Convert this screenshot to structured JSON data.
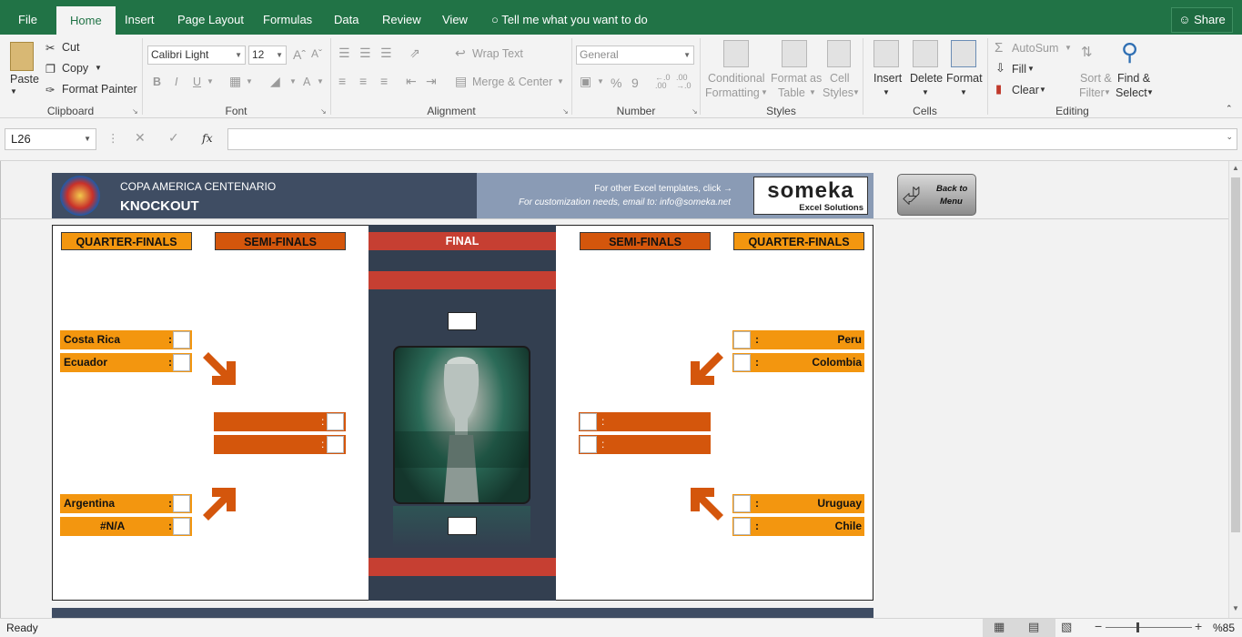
{
  "tabs": {
    "file": "File",
    "home": "Home",
    "insert": "Insert",
    "page_layout": "Page Layout",
    "formulas": "Formulas",
    "data": "Data",
    "review": "Review",
    "view": "View",
    "tell_me": "Tell me what you want to do",
    "share": "Share"
  },
  "clipboard": {
    "paste": "Paste",
    "cut": "Cut",
    "copy": "Copy",
    "format_painter": "Format Painter",
    "group": "Clipboard"
  },
  "font": {
    "name": "Calibri Light",
    "size": "12",
    "bold": "B",
    "italic": "I",
    "underline": "U",
    "color_a": "A",
    "group": "Font"
  },
  "alignment": {
    "wrap": "Wrap Text",
    "merge": "Merge & Center",
    "group": "Alignment"
  },
  "number": {
    "format": "General",
    "percent": "%",
    "comma": "9",
    "group": "Number"
  },
  "styles": {
    "conditional_l1": "Conditional",
    "conditional_l2": "Formatting",
    "format_table_l1": "Format as",
    "format_table_l2": "Table",
    "cell_styles_l1": "Cell",
    "cell_styles_l2": "Styles",
    "group": "Styles"
  },
  "cells": {
    "insert": "Insert",
    "delete": "Delete",
    "format": "Format",
    "group": "Cells"
  },
  "editing": {
    "autosum": "AutoSum",
    "fill": "Fill",
    "clear": "Clear",
    "sort_l1": "Sort &",
    "sort_l2": "Filter",
    "find_l1": "Find &",
    "find_l2": "Select",
    "group": "Editing"
  },
  "formula_bar": {
    "name_box": "L26",
    "fx": "fx",
    "value": ""
  },
  "banner": {
    "line1": "COPA AMERICA CENTENARIO",
    "line2": "KNOCKOUT",
    "promo1": "For other Excel templates, click →",
    "promo2": "For customization needs, email to: info@someka.net",
    "logo_main": "someka",
    "logo_sub": "Excel Solutions",
    "back_l1": "Back to",
    "back_l2": "Menu"
  },
  "bracket": {
    "quarter_finals": "QUARTER-FINALS",
    "semi_finals": "SEMI-FINALS",
    "final": "FINAL",
    "left": [
      {
        "team": "Costa Rica",
        "colon": ":"
      },
      {
        "team": "Ecuador",
        "colon": ":"
      },
      {
        "team": "Argentina",
        "colon": ":"
      },
      {
        "team": "#N/A",
        "colon": ":"
      }
    ],
    "right": [
      {
        "team": "Peru",
        "colon": ":"
      },
      {
        "team": "Colombia",
        "colon": ":"
      },
      {
        "team": "Uruguay",
        "colon": ":"
      },
      {
        "team": "Chile",
        "colon": ":"
      }
    ],
    "colon": ":"
  },
  "status": {
    "ready": "Ready",
    "zoom": "%85"
  },
  "colors": {
    "excel_green": "#217346",
    "qf_orange": "#f3960f",
    "sf_orange": "#d4560c",
    "final_red": "#c63f32",
    "panel_dark": "#333f50",
    "banner_dark": "#3f4d63"
  }
}
